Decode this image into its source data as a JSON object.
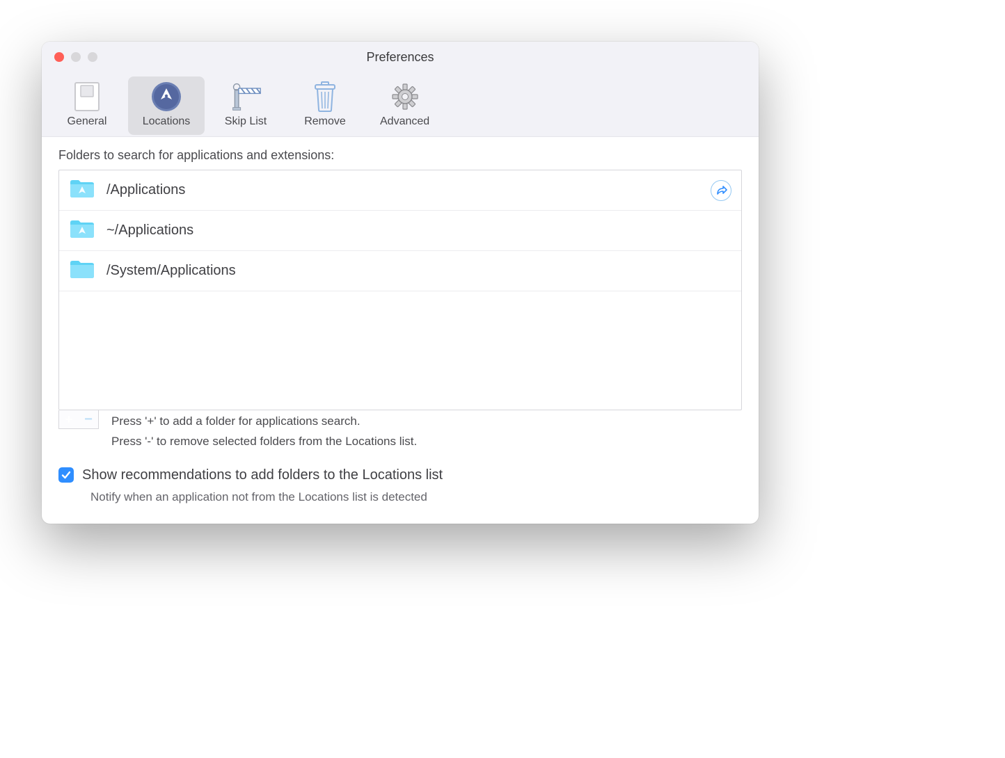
{
  "window": {
    "title": "Preferences"
  },
  "toolbar": {
    "tabs": [
      {
        "id": "general",
        "label": "General"
      },
      {
        "id": "locations",
        "label": "Locations"
      },
      {
        "id": "skiplist",
        "label": "Skip List"
      },
      {
        "id": "remove",
        "label": "Remove"
      },
      {
        "id": "advanced",
        "label": "Advanced"
      }
    ],
    "selected": "locations"
  },
  "section": {
    "label": "Folders to search for applications and extensions:"
  },
  "folders": [
    {
      "path": "/Applications",
      "icon": "apps-folder",
      "action": "reveal"
    },
    {
      "path": "~/Applications",
      "icon": "apps-folder",
      "action": null
    },
    {
      "path": "/System/Applications",
      "icon": "folder",
      "action": null
    }
  ],
  "hints": {
    "add": "Press '+' to add a folder for applications search.",
    "remove": "Press '-'  to remove selected folders from the Locations list."
  },
  "recommendations": {
    "checked": true,
    "label": "Show recommendations to add folders to the Locations list",
    "sub": "Notify when an application not from the Locations list is detected"
  }
}
